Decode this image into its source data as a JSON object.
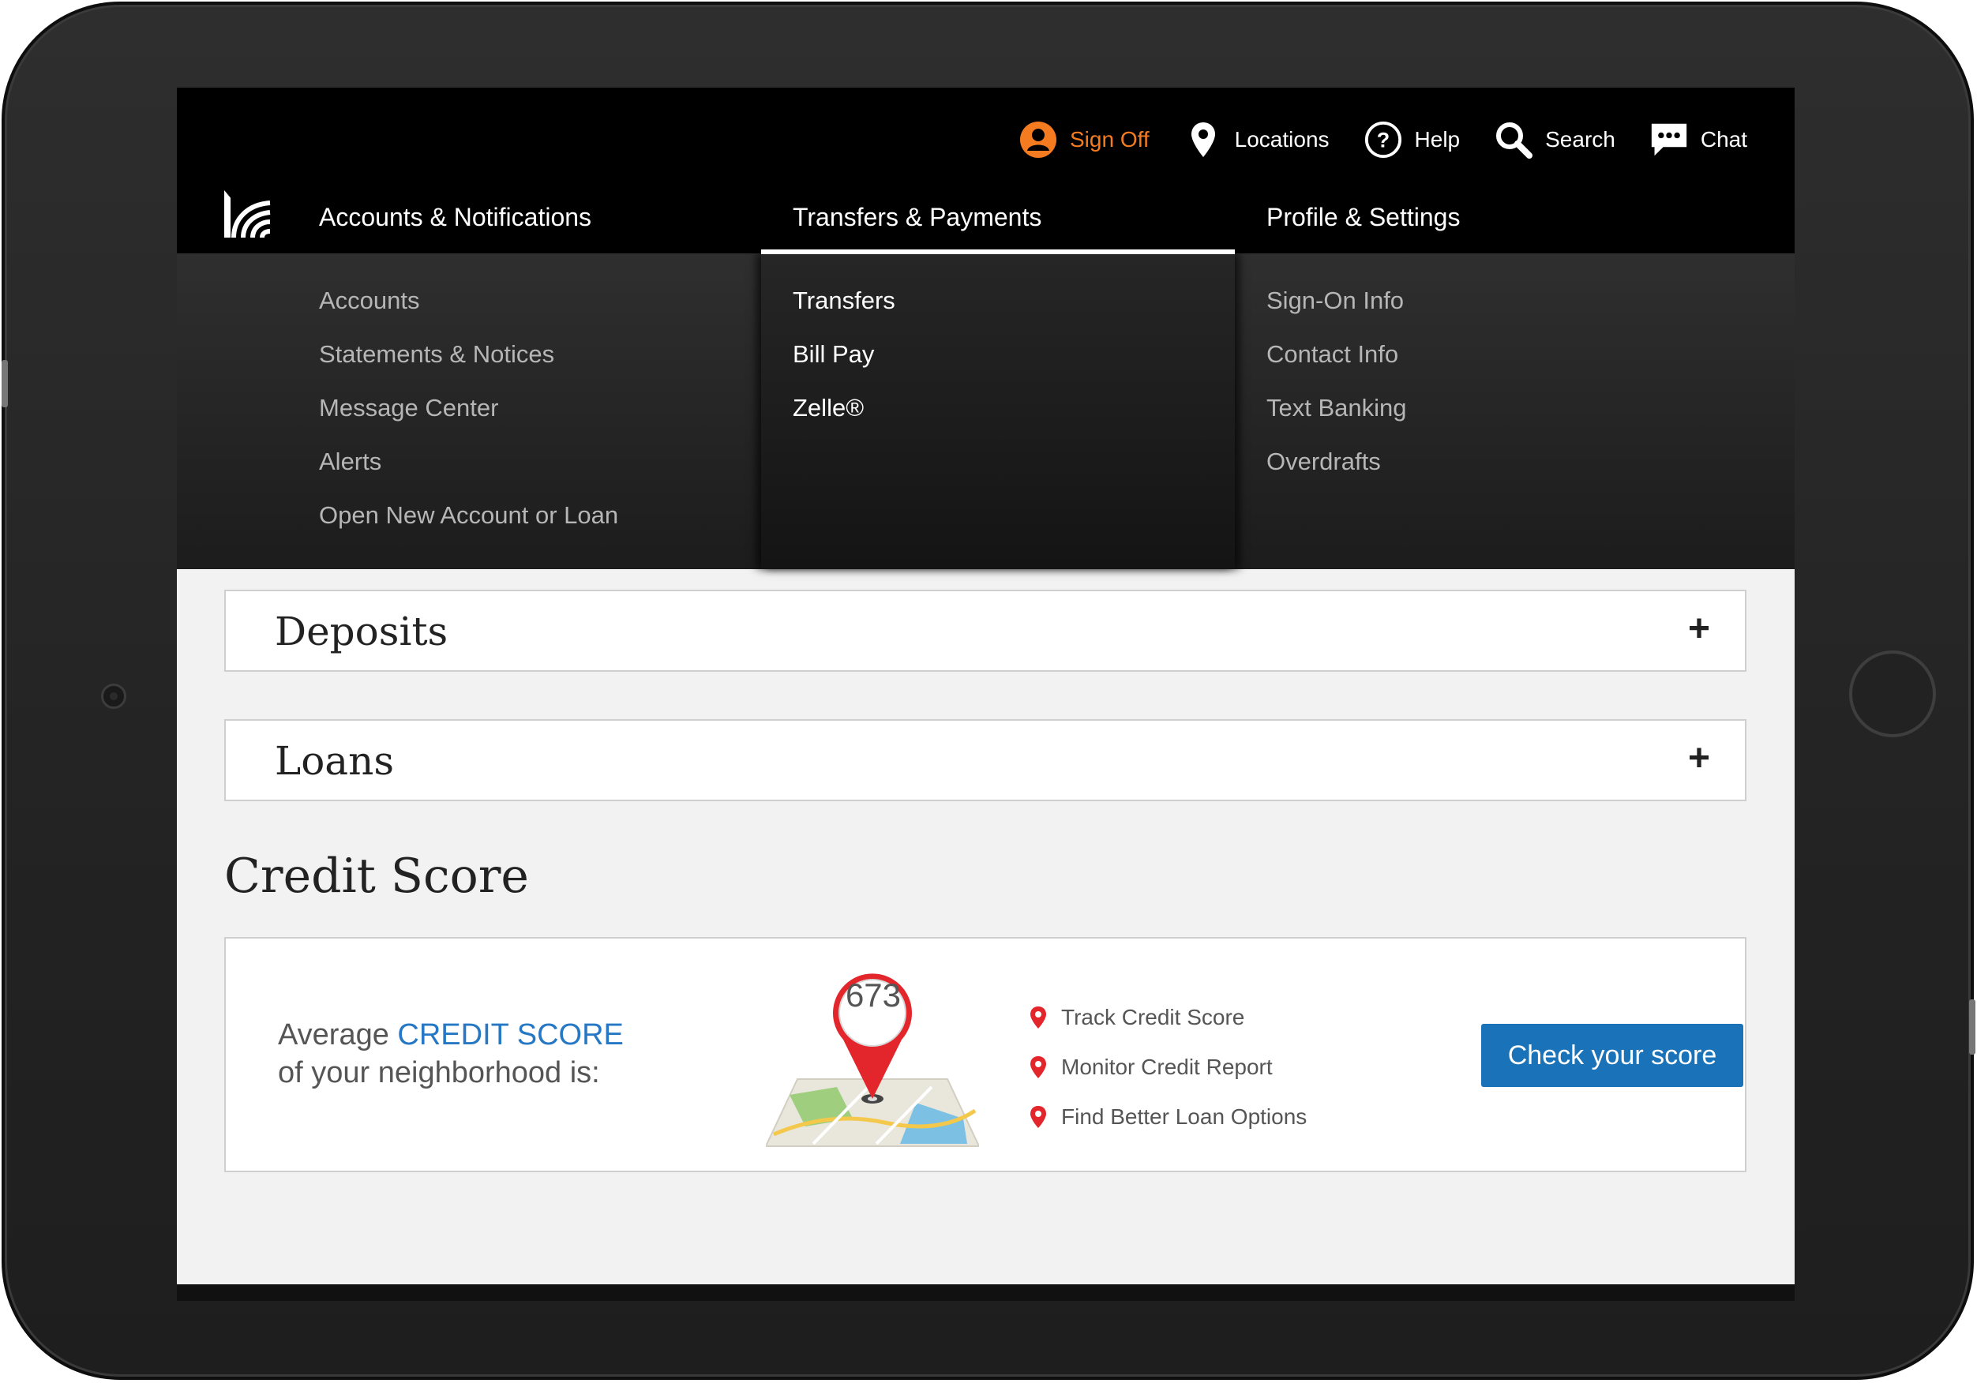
{
  "utility_nav": {
    "sign_off": "Sign Off",
    "locations": "Locations",
    "help": "Help",
    "search": "Search",
    "chat": "Chat"
  },
  "main_nav": {
    "tabs": [
      {
        "label": "Accounts & Notifications"
      },
      {
        "label": "Transfers & Payments",
        "active": true
      },
      {
        "label": "Profile & Settings"
      }
    ]
  },
  "menu": {
    "accounts": [
      "Accounts",
      "Statements & Notices",
      "Message Center",
      "Alerts",
      "Open New Account or Loan"
    ],
    "transfers": [
      "Transfers",
      "Bill Pay",
      "Zelle®"
    ],
    "profile": [
      "Sign-On Info",
      "Contact Info",
      "Text Banking",
      "Overdrafts"
    ]
  },
  "accordions": [
    {
      "title": "Deposits",
      "toggle": "+"
    },
    {
      "title": "Loans",
      "toggle": "+"
    }
  ],
  "credit_score": {
    "heading": "Credit Score",
    "text_before": "Average ",
    "text_highlight": "CREDIT SCORE",
    "text_after": " of your neighborhood is:",
    "score": "673",
    "features": [
      "Track Credit Score",
      "Monitor Credit Report",
      "Find Better Loan Options"
    ],
    "cta": "Check your score"
  },
  "colors": {
    "accent_orange": "#f47b20",
    "link_blue": "#2678c4",
    "button_blue": "#1a73b8",
    "pin_red": "#e3262b"
  },
  "icons": [
    "user-circle-icon",
    "location-pin-icon",
    "help-circle-icon",
    "search-icon",
    "chat-bubble-icon",
    "bank-logo-icon"
  ]
}
